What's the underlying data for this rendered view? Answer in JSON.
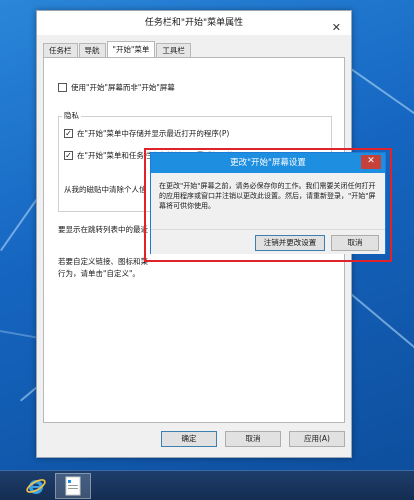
{
  "window": {
    "title": "任务栏和\"开始\"菜单属性",
    "close_glyph": "✕",
    "tabs": [
      "任务栏",
      "导航",
      "\"开始\"菜单",
      "工具栏"
    ],
    "active_tab": 2
  },
  "start_tab": {
    "use_start_screen": {
      "label": "使用\"开始\"屏幕而非\"开始\"屏幕",
      "checked": false
    },
    "privacy_group_label": "隐私",
    "store_programs": {
      "label": "在\"开始\"菜单中存储并显示最近打开的程序(P)",
      "checked": true
    },
    "store_items": {
      "label": "在\"开始\"菜单和任务栏中存储并显示最近打开的项目(M)",
      "checked": true
    },
    "clear_text": "从我的磁贴中清除个人信",
    "jumplist_text": "要显示在跳转列表中的最近",
    "customize_text_1": "若要自定义链接、图标和菜",
    "customize_text_2": "行为，请单击\"自定义\"。"
  },
  "footer_buttons": {
    "ok": "确定",
    "cancel": "取消",
    "apply": "应用(A)"
  },
  "modal": {
    "title": "更改\"开始\"屏幕设置",
    "close_glyph": "✕",
    "message": "在更改\"开始\"屏幕之前，请务必保存你的工作。我们需要关闭任何打开的应用程序或窗口并注销以更改此设置。然后，请重新登录，\"开始\"屏幕将可供你使用。",
    "signout_button": "注销并更改设置",
    "cancel_button": "取消"
  },
  "taskbar": {
    "items": [
      "ie-icon",
      "properties-window-icon"
    ]
  },
  "colors": {
    "modal_title_bg": "#1e8fe0",
    "highlight_outline": "#e0232b",
    "close_button_bg": "#c7413b",
    "desktop_blue": "#1565c0"
  }
}
